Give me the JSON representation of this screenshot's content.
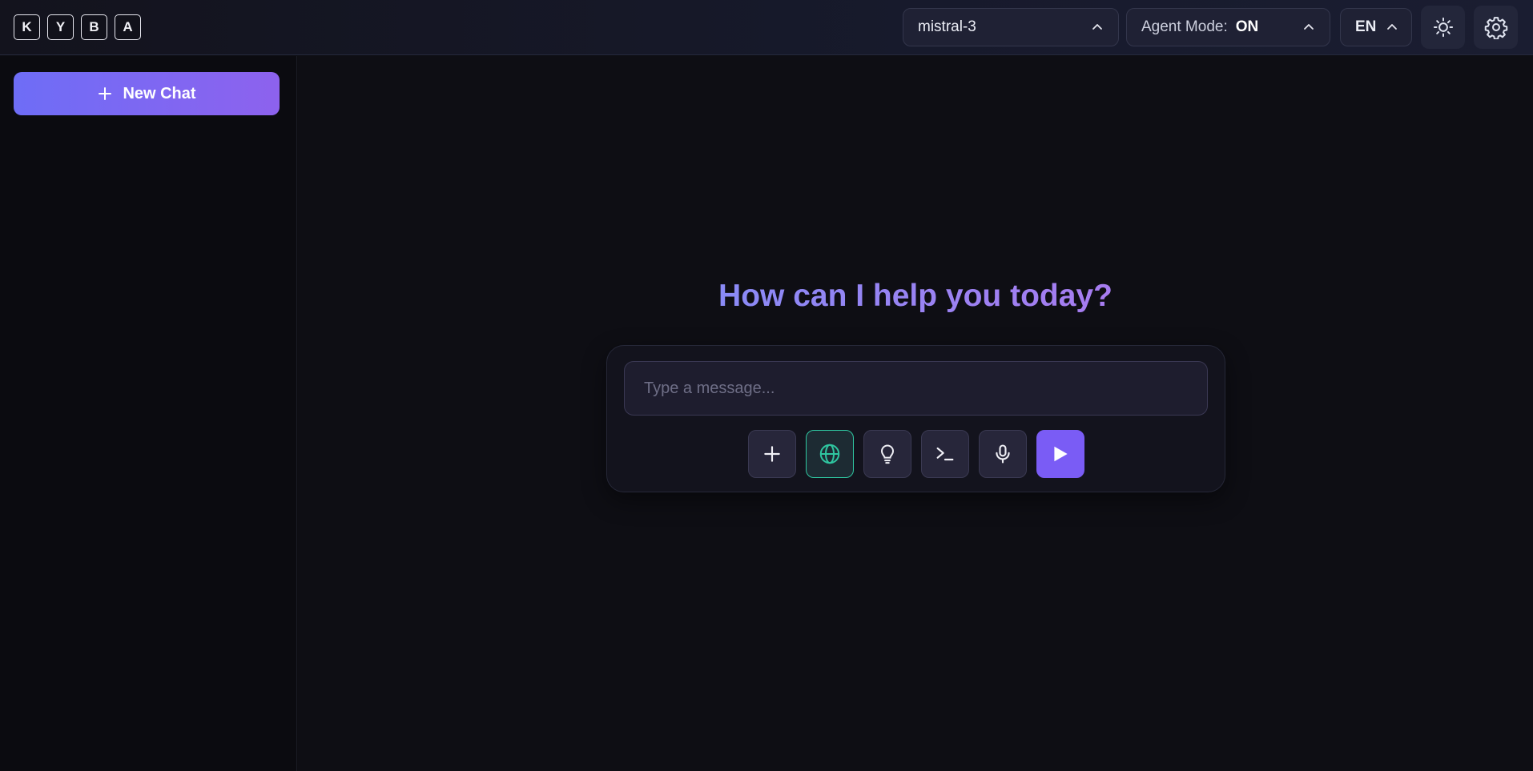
{
  "header": {
    "logo_letters": [
      "K",
      "Y",
      "B",
      "A"
    ],
    "model_select": {
      "value": "mistral-3",
      "icon": "chevron-up-icon"
    },
    "agent_mode": {
      "label": "Agent Mode:",
      "value": "ON",
      "icon": "chevron-up-icon"
    },
    "language": {
      "value": "EN",
      "icon": "chevron-up-icon"
    },
    "theme_toggle_icon": "sun-icon",
    "settings_icon": "gear-icon"
  },
  "sidebar": {
    "new_chat_label": "New Chat",
    "new_chat_icon": "plus-icon"
  },
  "main": {
    "headline": "How can I help you today?",
    "input_placeholder": "Type a message...",
    "toolbar": [
      "plus-icon",
      "globe-icon",
      "lightbulb-icon",
      "terminal-icon",
      "microphone-icon",
      "send-icon"
    ],
    "web_search_active": true
  },
  "colors": {
    "accent": "#7a5cf5",
    "gradient_start": "#6e6df6",
    "gradient_end": "#8d62ee",
    "active_tool": "#2fc6a0",
    "background": "#0e0e14"
  }
}
